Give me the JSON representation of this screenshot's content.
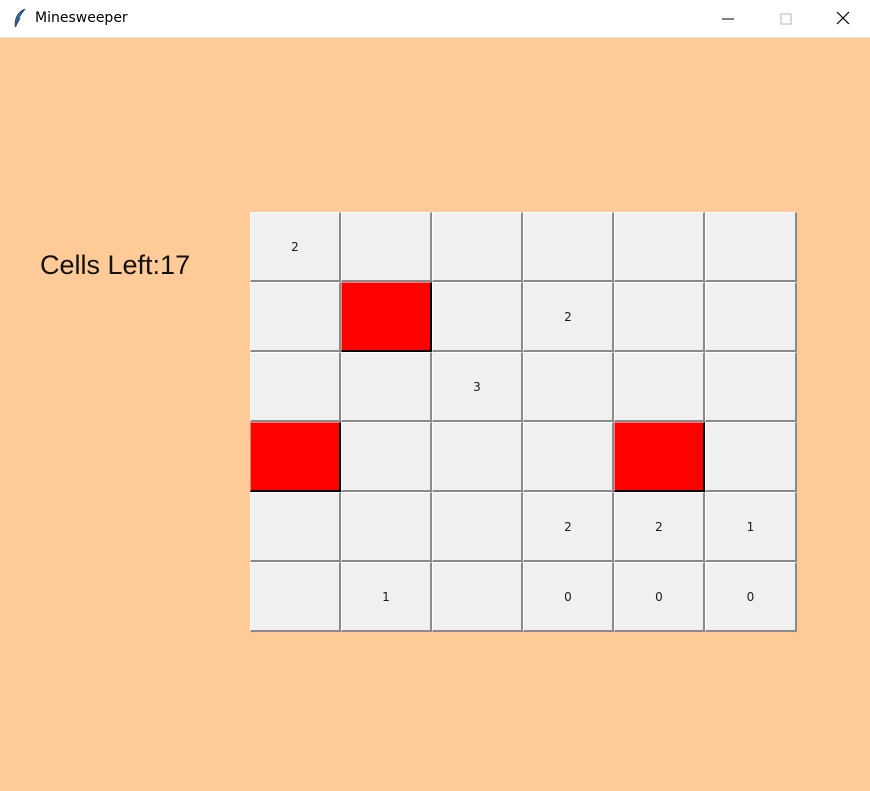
{
  "window": {
    "title": "Minesweeper",
    "icon": "feather-icon"
  },
  "status": {
    "cells_left_text": "Cells Left:17"
  },
  "colors": {
    "background": "#FECB98",
    "cell": "#F0F0F0",
    "mine": "#FF0000"
  },
  "board": {
    "rows": [
      [
        {
          "text": "2",
          "state": "revealed"
        },
        {
          "text": "",
          "state": "hidden"
        },
        {
          "text": "",
          "state": "hidden"
        },
        {
          "text": "",
          "state": "hidden"
        },
        {
          "text": "",
          "state": "hidden"
        },
        {
          "text": "",
          "state": "hidden"
        }
      ],
      [
        {
          "text": "",
          "state": "hidden"
        },
        {
          "text": "",
          "state": "mine"
        },
        {
          "text": "",
          "state": "hidden"
        },
        {
          "text": "2",
          "state": "revealed"
        },
        {
          "text": "",
          "state": "hidden"
        },
        {
          "text": "",
          "state": "hidden"
        }
      ],
      [
        {
          "text": "",
          "state": "hidden"
        },
        {
          "text": "",
          "state": "hidden"
        },
        {
          "text": "3",
          "state": "revealed"
        },
        {
          "text": "",
          "state": "hidden"
        },
        {
          "text": "",
          "state": "hidden"
        },
        {
          "text": "",
          "state": "hidden"
        }
      ],
      [
        {
          "text": "",
          "state": "mine"
        },
        {
          "text": "",
          "state": "hidden"
        },
        {
          "text": "",
          "state": "hidden"
        },
        {
          "text": "",
          "state": "hidden"
        },
        {
          "text": "",
          "state": "mine"
        },
        {
          "text": "",
          "state": "hidden"
        }
      ],
      [
        {
          "text": "",
          "state": "hidden"
        },
        {
          "text": "",
          "state": "hidden"
        },
        {
          "text": "",
          "state": "hidden"
        },
        {
          "text": "2",
          "state": "revealed"
        },
        {
          "text": "2",
          "state": "revealed"
        },
        {
          "text": "1",
          "state": "revealed"
        }
      ],
      [
        {
          "text": "",
          "state": "hidden"
        },
        {
          "text": "1",
          "state": "revealed"
        },
        {
          "text": "",
          "state": "hidden"
        },
        {
          "text": "0",
          "state": "revealed"
        },
        {
          "text": "0",
          "state": "revealed"
        },
        {
          "text": "0",
          "state": "revealed"
        }
      ]
    ]
  }
}
